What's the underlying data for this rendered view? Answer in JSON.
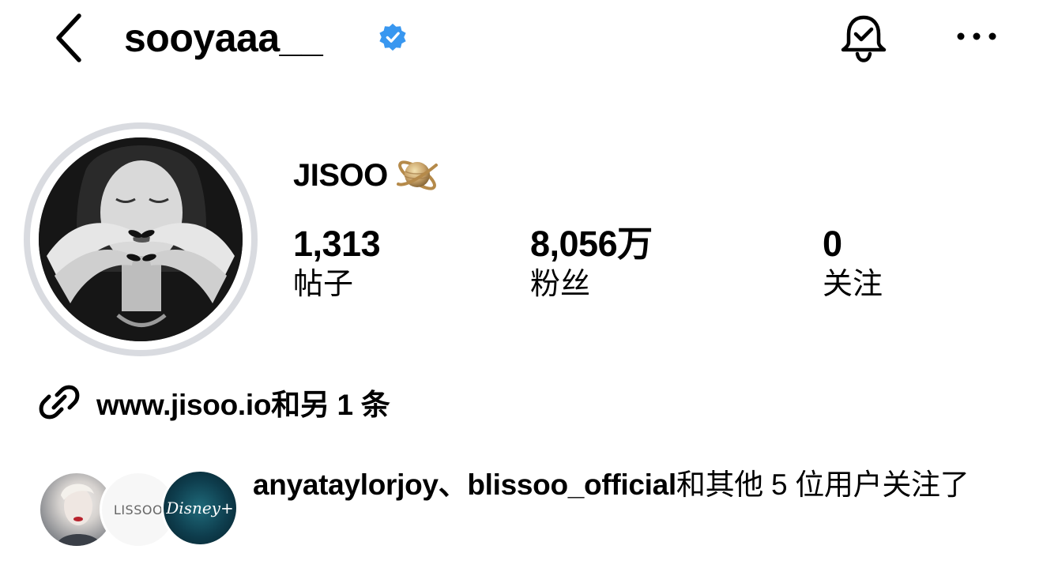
{
  "header": {
    "username": "sooyaaa__",
    "verified": true,
    "accent_color": "#3897f0"
  },
  "profile": {
    "display_name": "JISOO",
    "name_emoji": "saturn-planet",
    "stats": {
      "posts": {
        "value": "1,313",
        "label": "帖子"
      },
      "followers": {
        "value": "8,056万",
        "label": "粉丝"
      },
      "following": {
        "value": "0",
        "label": "关注"
      }
    },
    "link": {
      "text": "www.jisoo.io和另 1 条",
      "icon": "link-icon"
    }
  },
  "followed_by": {
    "avatars": [
      {
        "name": "anyataylorjoy",
        "label": ""
      },
      {
        "name": "blissoo_official",
        "label": "LISSOO"
      },
      {
        "name": "disney-plus",
        "label": "Disney+"
      }
    ],
    "users_text": "anyataylorjoy、blissoo_official",
    "rest_text": "和其他 5 位用户关注了"
  }
}
